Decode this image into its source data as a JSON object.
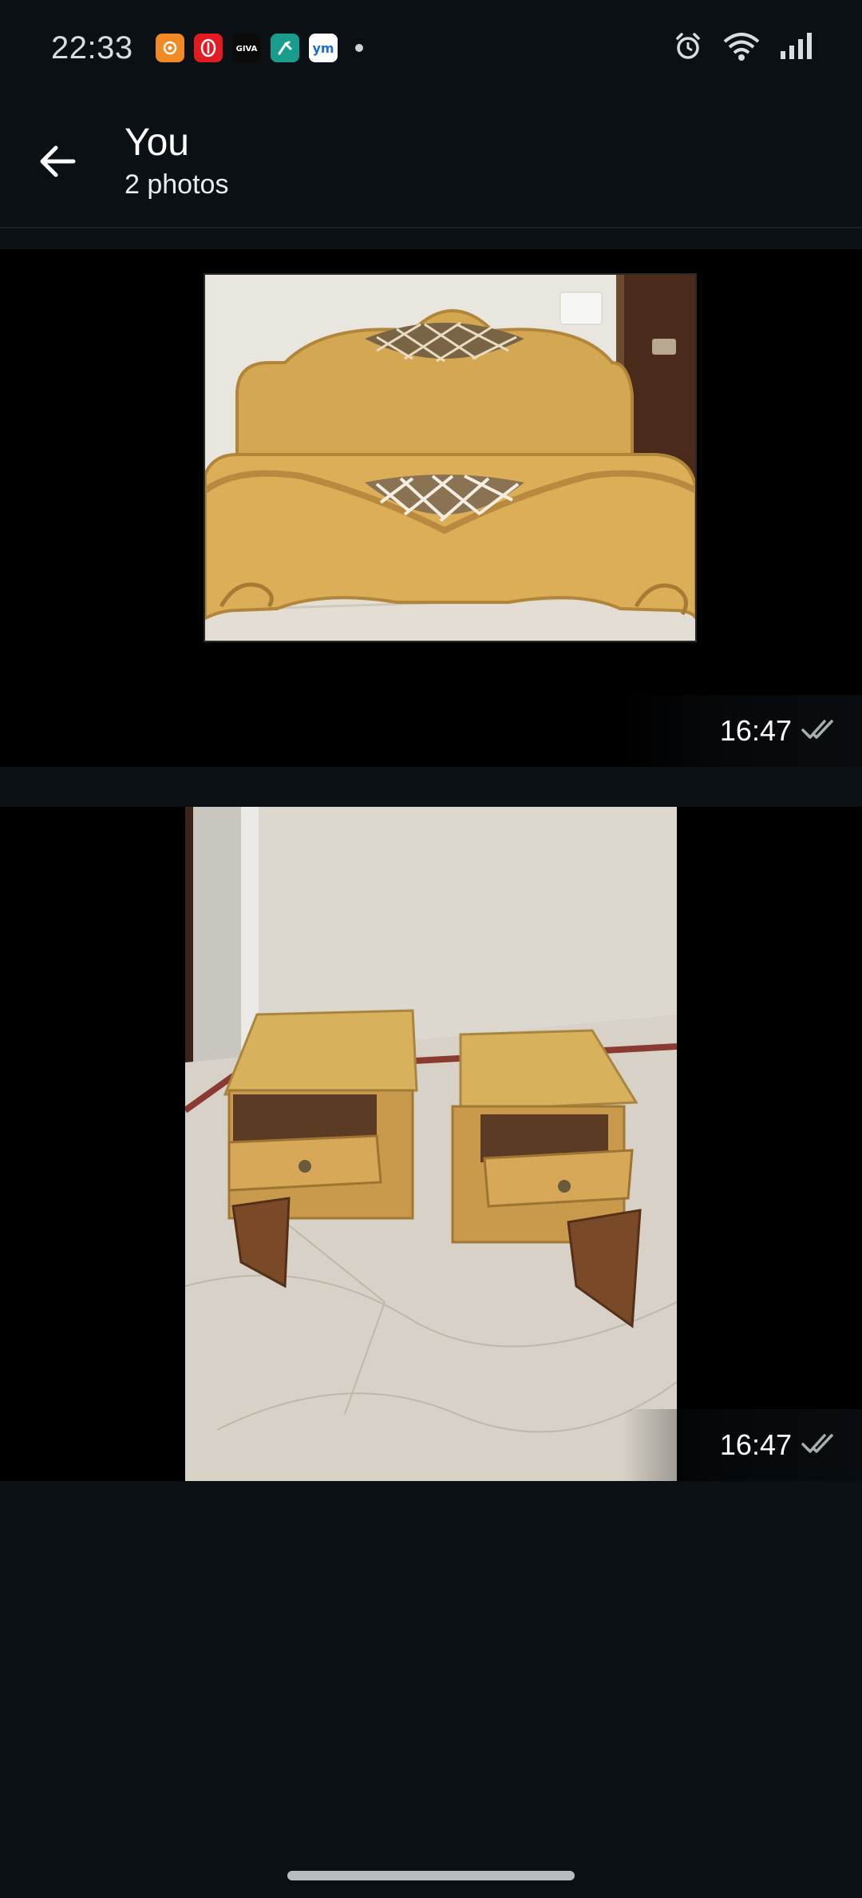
{
  "status_bar": {
    "time": "22:33",
    "notification_icons": [
      {
        "name": "app-orange-icon",
        "color": "#f08a24",
        "glyph": "✺"
      },
      {
        "name": "app-red-icon",
        "color": "#e21b22",
        "glyph": "⦿"
      },
      {
        "name": "giva-icon",
        "color": "#111111",
        "glyph": "GIVA"
      },
      {
        "name": "app-teal-icon",
        "color": "#1a9c8c",
        "glyph": "⬈"
      },
      {
        "name": "ym-icon",
        "color": "#ffffff",
        "glyph": "ym"
      }
    ]
  },
  "header": {
    "title": "You",
    "subtitle": "2 photos"
  },
  "media": [
    {
      "time": "16:47",
      "description_icon": "double-check-icon"
    },
    {
      "time": "16:47",
      "description_icon": "double-check-icon"
    }
  ],
  "colors": {
    "background": "#0b1014",
    "media_background": "#000000",
    "text": "#e9edef"
  }
}
